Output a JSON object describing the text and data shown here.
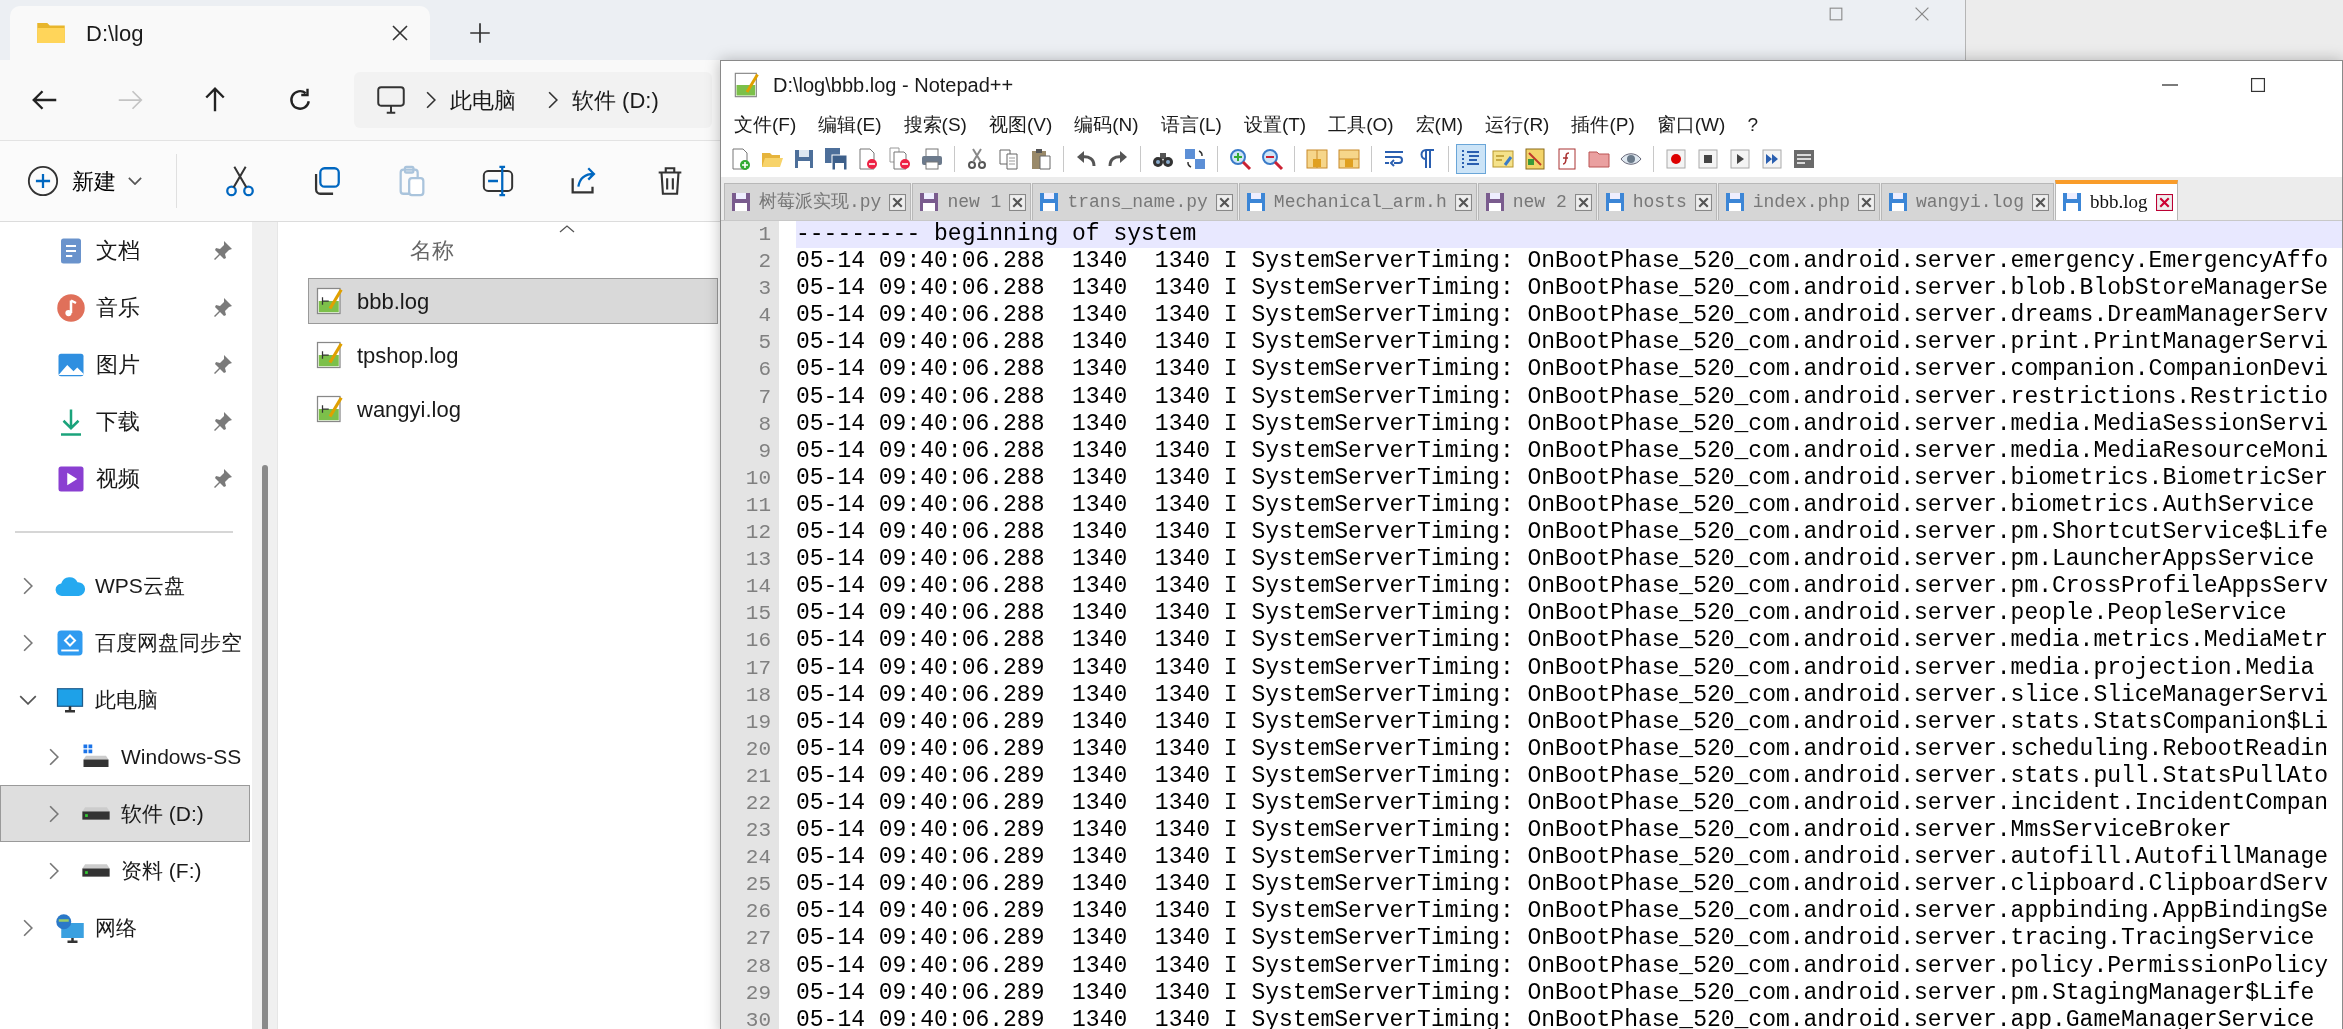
{
  "explorer": {
    "tab_title": "D:\\log",
    "nav_buttons": [
      {
        "disabled": false
      },
      {
        "disabled": true
      },
      {
        "disabled": false
      },
      {
        "disabled": false
      }
    ],
    "address": [
      "此电脑",
      "软件 (D:)"
    ],
    "new_label": "新建",
    "commands": [
      {
        "disabled": false
      },
      {
        "disabled": false
      },
      {
        "disabled": true
      },
      {
        "disabled": false
      },
      {
        "disabled": false
      },
      {
        "disabled": false
      }
    ],
    "quick_access": [
      {
        "label": "文档"
      },
      {
        "label": "音乐"
      },
      {
        "label": "图片"
      },
      {
        "label": "下载"
      },
      {
        "label": "视频"
      }
    ],
    "tree": [
      {
        "label": "WPS云盘",
        "kind": "cloud",
        "expanded": false,
        "selected": false
      },
      {
        "label": "百度网盘同步空",
        "kind": "sync",
        "expanded": false,
        "selected": false
      },
      {
        "label": "此电脑",
        "kind": "computer",
        "expanded": true,
        "selected": false,
        "children": [
          {
            "label": "Windows-SS",
            "kind": "system",
            "expanded": false,
            "selected": false
          },
          {
            "label": "软件 (D:)",
            "kind": "drive",
            "expanded": false,
            "selected": true
          },
          {
            "label": "资料 (F:)",
            "kind": "drive",
            "expanded": false,
            "selected": false
          }
        ]
      },
      {
        "label": "网络",
        "kind": "network",
        "expanded": false,
        "selected": false
      }
    ],
    "column": "名称",
    "files": [
      {
        "name": "bbb.log",
        "selected": true
      },
      {
        "name": "tpshop.log",
        "selected": false
      },
      {
        "name": "wangyi.log",
        "selected": false
      }
    ]
  },
  "notepad": {
    "title": "D:\\log\\bbb.log - Notepad++",
    "menu": [
      "文件(F)",
      "编辑(E)",
      "搜索(S)",
      "视图(V)",
      "编码(N)",
      "语言(L)",
      "设置(T)",
      "工具(O)",
      "宏(M)",
      "运行(R)",
      "插件(P)",
      "窗口(W)",
      "?"
    ],
    "toolbar": [
      {
        "pressed": false
      },
      {
        "pressed": false
      },
      {
        "pressed": false
      },
      {
        "pressed": false
      },
      {
        "pressed": false
      },
      {
        "pressed": false
      },
      {
        "pressed": false
      },
      {
        "pressed": false
      },
      {
        "pressed": false
      },
      {
        "pressed": false
      },
      {
        "pressed": false
      },
      {
        "pressed": false
      },
      {
        "pressed": false
      },
      {
        "pressed": false
      },
      {
        "pressed": false
      },
      {
        "pressed": false
      },
      {
        "pressed": false
      },
      {
        "pressed": false
      },
      {
        "pressed": false
      },
      {
        "pressed": false
      },
      {
        "pressed": true
      },
      {
        "pressed": false
      },
      {
        "pressed": false
      },
      {
        "pressed": false
      },
      {
        "pressed": false
      },
      {
        "pressed": false
      },
      {
        "pressed": false
      },
      {
        "pressed": false
      },
      {
        "pressed": false
      },
      {
        "pressed": false
      },
      {
        "pressed": false
      }
    ],
    "tabs": [
      {
        "label": "树莓派实现.py",
        "modified": true,
        "selected": false
      },
      {
        "label": "new 1",
        "modified": true,
        "selected": false
      },
      {
        "label": "trans_name.py",
        "modified": false,
        "selected": false
      },
      {
        "label": "Mechanical_arm.h",
        "modified": false,
        "selected": false
      },
      {
        "label": "new 2",
        "modified": true,
        "selected": false
      },
      {
        "label": "hosts",
        "modified": false,
        "selected": false
      },
      {
        "label": "index.php",
        "modified": false,
        "selected": false
      },
      {
        "label": "wangyi.log",
        "modified": false,
        "selected": false
      },
      {
        "label": "bbb.log",
        "modified": false,
        "selected": true
      }
    ],
    "lines": [
      {
        "number": "1",
        "text": "--------- beginning of system",
        "current": true
      },
      {
        "number": "2",
        "text": "05-14 09:40:06.288  1340  1340 I SystemServerTiming: OnBootPhase_520_com.android.server.emergency.EmergencyAffo",
        "current": false
      },
      {
        "number": "3",
        "text": "05-14 09:40:06.288  1340  1340 I SystemServerTiming: OnBootPhase_520_com.android.server.blob.BlobStoreManagerSe",
        "current": false
      },
      {
        "number": "4",
        "text": "05-14 09:40:06.288  1340  1340 I SystemServerTiming: OnBootPhase_520_com.android.server.dreams.DreamManagerServ",
        "current": false
      },
      {
        "number": "5",
        "text": "05-14 09:40:06.288  1340  1340 I SystemServerTiming: OnBootPhase_520_com.android.server.print.PrintManagerServi",
        "current": false
      },
      {
        "number": "6",
        "text": "05-14 09:40:06.288  1340  1340 I SystemServerTiming: OnBootPhase_520_com.android.server.companion.CompanionDevi",
        "current": false
      },
      {
        "number": "7",
        "text": "05-14 09:40:06.288  1340  1340 I SystemServerTiming: OnBootPhase_520_com.android.server.restrictions.Restrictio",
        "current": false
      },
      {
        "number": "8",
        "text": "05-14 09:40:06.288  1340  1340 I SystemServerTiming: OnBootPhase_520_com.android.server.media.MediaSessionServi",
        "current": false
      },
      {
        "number": "9",
        "text": "05-14 09:40:06.288  1340  1340 I SystemServerTiming: OnBootPhase_520_com.android.server.media.MediaResourceMoni",
        "current": false
      },
      {
        "number": "10",
        "text": "05-14 09:40:06.288  1340  1340 I SystemServerTiming: OnBootPhase_520_com.android.server.biometrics.BiometricSer",
        "current": false
      },
      {
        "number": "11",
        "text": "05-14 09:40:06.288  1340  1340 I SystemServerTiming: OnBootPhase_520_com.android.server.biometrics.AuthService",
        "current": false
      },
      {
        "number": "12",
        "text": "05-14 09:40:06.288  1340  1340 I SystemServerTiming: OnBootPhase_520_com.android.server.pm.ShortcutService$Life",
        "current": false
      },
      {
        "number": "13",
        "text": "05-14 09:40:06.288  1340  1340 I SystemServerTiming: OnBootPhase_520_com.android.server.pm.LauncherAppsService",
        "current": false
      },
      {
        "number": "14",
        "text": "05-14 09:40:06.288  1340  1340 I SystemServerTiming: OnBootPhase_520_com.android.server.pm.CrossProfileAppsServ",
        "current": false
      },
      {
        "number": "15",
        "text": "05-14 09:40:06.288  1340  1340 I SystemServerTiming: OnBootPhase_520_com.android.server.people.PeopleService",
        "current": false
      },
      {
        "number": "16",
        "text": "05-14 09:40:06.288  1340  1340 I SystemServerTiming: OnBootPhase_520_com.android.server.media.metrics.MediaMetr",
        "current": false
      },
      {
        "number": "17",
        "text": "05-14 09:40:06.289  1340  1340 I SystemServerTiming: OnBootPhase_520_com.android.server.media.projection.Media",
        "current": false
      },
      {
        "number": "18",
        "text": "05-14 09:40:06.289  1340  1340 I SystemServerTiming: OnBootPhase_520_com.android.server.slice.SliceManagerServi",
        "current": false
      },
      {
        "number": "19",
        "text": "05-14 09:40:06.289  1340  1340 I SystemServerTiming: OnBootPhase_520_com.android.server.stats.StatsCompanion$Li",
        "current": false
      },
      {
        "number": "20",
        "text": "05-14 09:40:06.289  1340  1340 I SystemServerTiming: OnBootPhase_520_com.android.server.scheduling.RebootReadin",
        "current": false
      },
      {
        "number": "21",
        "text": "05-14 09:40:06.289  1340  1340 I SystemServerTiming: OnBootPhase_520_com.android.server.stats.pull.StatsPullAto",
        "current": false
      },
      {
        "number": "22",
        "text": "05-14 09:40:06.289  1340  1340 I SystemServerTiming: OnBootPhase_520_com.android.server.incident.IncidentCompan",
        "current": false
      },
      {
        "number": "23",
        "text": "05-14 09:40:06.289  1340  1340 I SystemServerTiming: OnBootPhase_520_com.android.server.MmsServiceBroker",
        "current": false
      },
      {
        "number": "24",
        "text": "05-14 09:40:06.289  1340  1340 I SystemServerTiming: OnBootPhase_520_com.android.server.autofill.AutofillManage",
        "current": false
      },
      {
        "number": "25",
        "text": "05-14 09:40:06.289  1340  1340 I SystemServerTiming: OnBootPhase_520_com.android.server.clipboard.ClipboardServ",
        "current": false
      },
      {
        "number": "26",
        "text": "05-14 09:40:06.289  1340  1340 I SystemServerTiming: OnBootPhase_520_com.android.server.appbinding.AppBindingSe",
        "current": false
      },
      {
        "number": "27",
        "text": "05-14 09:40:06.289  1340  1340 I SystemServerTiming: OnBootPhase_520_com.android.server.tracing.TracingService",
        "current": false
      },
      {
        "number": "28",
        "text": "05-14 09:40:06.289  1340  1340 I SystemServerTiming: OnBootPhase_520_com.android.server.policy.PermissionPolicy",
        "current": false
      },
      {
        "number": "29",
        "text": "05-14 09:40:06.289  1340  1340 I SystemServerTiming: OnBootPhase_520_com.android.server.pm.StagingManager$Life",
        "current": false
      },
      {
        "number": "30",
        "text": "05-14 09:40:06.289  1340  1340 I SystemServerTiming: OnBootPhase_520_com.android.server.app.GameManagerService",
        "current": false
      }
    ]
  }
}
